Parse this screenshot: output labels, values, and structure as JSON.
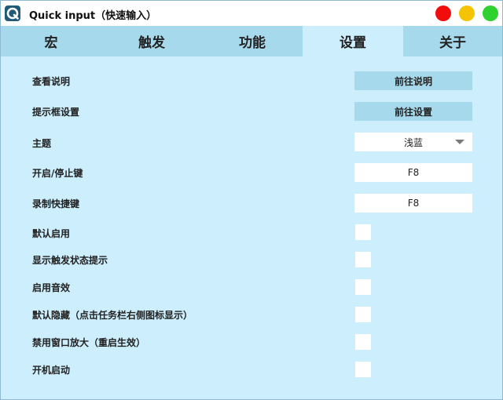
{
  "window": {
    "title": "Quick input（快速输入）",
    "icon": "q-logo-icon",
    "controls": {
      "close_color": "#f20d0d",
      "minimize_color": "#f5c400",
      "maximize_color": "#2ed12e"
    }
  },
  "tabs": [
    {
      "label": "宏"
    },
    {
      "label": "触发"
    },
    {
      "label": "功能"
    },
    {
      "label": "设置",
      "active": true
    },
    {
      "label": "关于"
    }
  ],
  "settings": {
    "view_help": {
      "label": "查看说明",
      "button": "前往说明"
    },
    "prompt_box": {
      "label": "提示框设置",
      "button": "前往设置"
    },
    "theme": {
      "label": "主题",
      "value": "浅蓝"
    },
    "start_stop_key": {
      "label": "开启/停止键",
      "value": "F8"
    },
    "record_shortcut": {
      "label": "录制快捷键",
      "value": "F8"
    },
    "default_enable": {
      "label": "默认启用",
      "checked": false
    },
    "show_trigger_status": {
      "label": "显示触发状态提示",
      "checked": false
    },
    "enable_sound": {
      "label": "启用音效",
      "checked": false
    },
    "default_hidden": {
      "label": "默认隐藏（点击任务栏右侧图标显示）",
      "checked": false
    },
    "disable_maximize": {
      "label": "禁用窗口放大（重启生效）",
      "checked": false
    },
    "autostart": {
      "label": "开机启动",
      "checked": false
    }
  },
  "colors": {
    "background": "#cdeefc",
    "tab_bar": "#a7d9ec",
    "button": "#a7d9ec"
  }
}
